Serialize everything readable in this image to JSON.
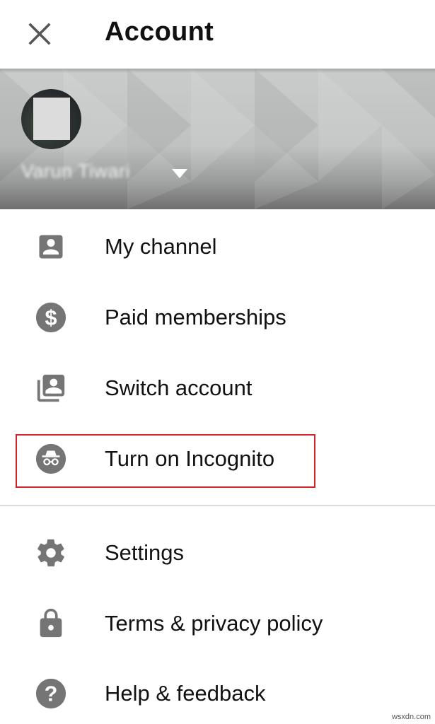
{
  "header": {
    "close_icon": "close-icon",
    "title": "Account"
  },
  "profile": {
    "account_name": "Varun Tiwari",
    "switch_icon": "caret-down-icon"
  },
  "menu": [
    {
      "label": "My channel",
      "icon": "account-box-icon"
    },
    {
      "label": "Paid memberships",
      "icon": "dollar-circle-icon"
    },
    {
      "label": "Switch account",
      "icon": "switch-account-icon"
    },
    {
      "label": "Turn on Incognito",
      "icon": "incognito-icon",
      "highlighted": true
    },
    {
      "label": "Settings",
      "icon": "gear-icon"
    },
    {
      "label": "Terms & privacy policy",
      "icon": "lock-icon"
    },
    {
      "label": "Help & feedback",
      "icon": "help-circle-icon"
    }
  ],
  "colors": {
    "icon_gray": "#757575",
    "highlight_red": "#d2232a",
    "divider": "#dcdcdc"
  },
  "watermark": "wsxdn.com"
}
